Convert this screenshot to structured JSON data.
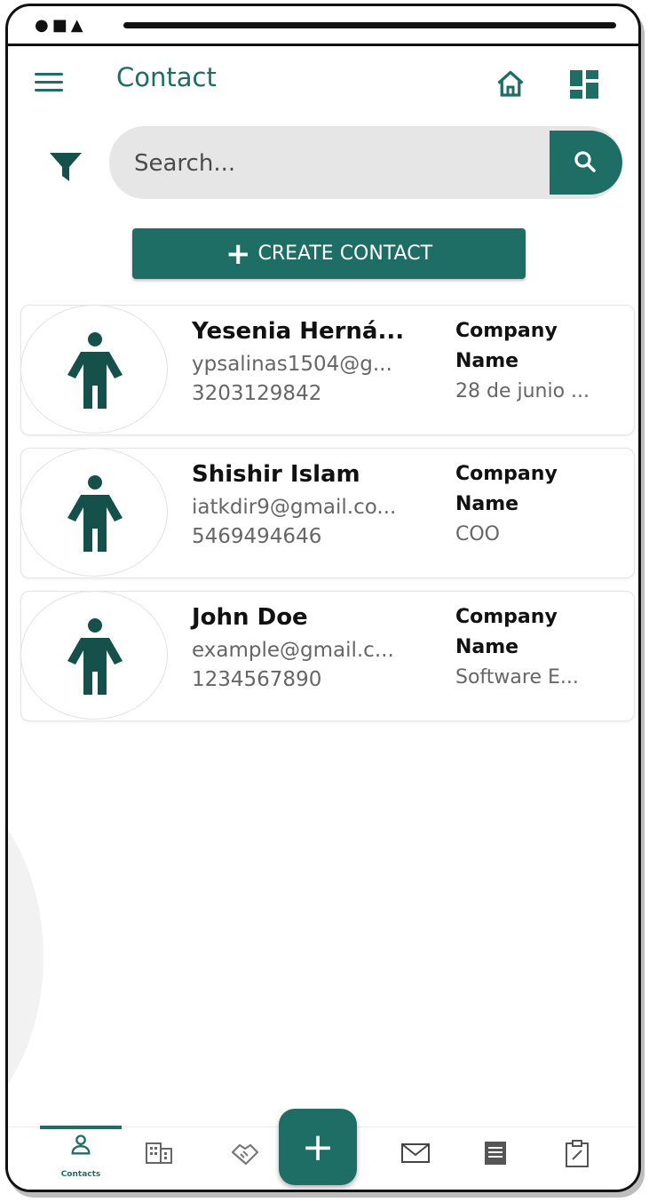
{
  "app": {
    "title": "Contact"
  },
  "search": {
    "placeholder": "Search..."
  },
  "actions": {
    "create_label": "CREATE CONTACT",
    "fab_label": "+"
  },
  "contacts": [
    {
      "name": "Yesenia Herná...",
      "email": "ypsalinas1504@g...",
      "phone": "3203129842",
      "company_label": "Company Name",
      "company_value": "28 de junio ..."
    },
    {
      "name": "Shishir Islam",
      "email": "iatkdir9@gmail.co...",
      "phone": "5469494646",
      "company_label": "Company Name",
      "company_value": "COO"
    },
    {
      "name": "John Doe",
      "email": "example@gmail.c...",
      "phone": "1234567890",
      "company_label": "Company Name",
      "company_value": "Software E..."
    }
  ],
  "bottom_nav": {
    "active_label": "Contacts",
    "items": [
      "contacts-icon",
      "building-icon",
      "handshake-icon",
      "mail-icon",
      "document-icon",
      "clipboard-icon"
    ]
  },
  "colors": {
    "accent": "#1e6e65",
    "avatar_icon": "#15514a"
  }
}
